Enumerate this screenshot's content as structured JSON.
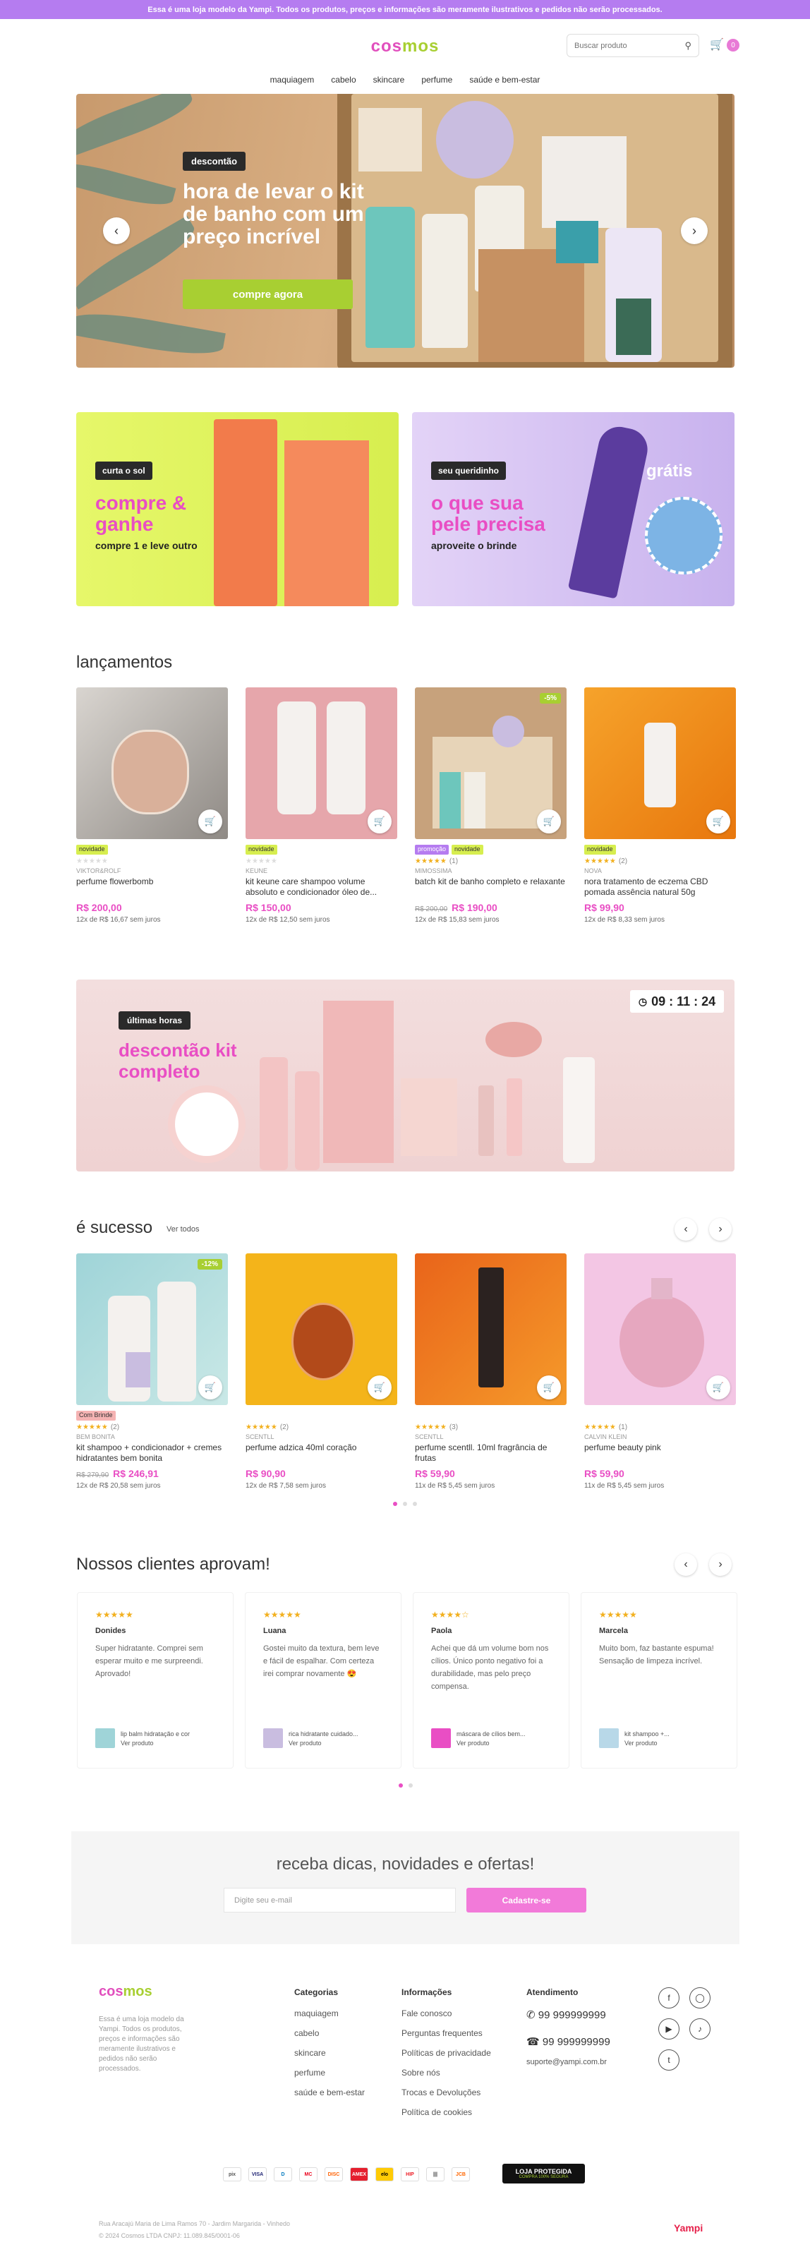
{
  "topbar": "Essa é uma loja modelo da Yampi. Todos os produtos, preços e informações são meramente ilustrativos e pedidos não serão processados.",
  "logo": {
    "part1": "cos",
    "part2": "mos"
  },
  "search": {
    "placeholder": "Buscar produto"
  },
  "cart": {
    "count": "0"
  },
  "nav": [
    "maquiagem",
    "cabelo",
    "skincare",
    "perfume",
    "saúde e bem-estar"
  ],
  "hero": {
    "tag": "descontão",
    "title": "hora de levar o kit de banho com um preço incrível",
    "button": "compre agora"
  },
  "promos": [
    {
      "tag": "curta o sol",
      "title": "compre & ganhe",
      "subtitle": "compre 1 e leve outro"
    },
    {
      "tag": "seu queridinho",
      "title": "o que sua pele precisa",
      "subtitle": "aproveite o brinde",
      "extra": "grátis"
    }
  ],
  "launches": {
    "title": "lançamentos",
    "products": [
      {
        "badges": [
          "novidade"
        ],
        "rating": "",
        "brand": "VIKTOR&ROLF",
        "name": "perfume flowerbomb",
        "old": "",
        "price": "R$ 200,00",
        "inst": "12x de R$ 16,67 sem juros",
        "discount": ""
      },
      {
        "badges": [
          "novidade"
        ],
        "rating": "",
        "brand": "KEUNE",
        "name": "kit keune care shampoo volume absoluto e condicionador óleo de...",
        "old": "",
        "price": "R$ 150,00",
        "inst": "12x de R$ 12,50 sem juros",
        "discount": ""
      },
      {
        "badges": [
          "promoção",
          "novidade"
        ],
        "rating": "(1)",
        "brand": "MIMOSSIMA",
        "name": "batch kit de banho completo e relaxante",
        "old": "R$ 200,00",
        "price": "R$ 190,00",
        "inst": "12x de R$ 15,83 sem juros",
        "discount": "-5%"
      },
      {
        "badges": [
          "novidade"
        ],
        "rating": "(2)",
        "brand": "NOVA",
        "name": "nora tratamento de eczema CBD pomada assência natural 50g",
        "old": "",
        "price": "R$ 99,90",
        "inst": "12x de R$ 8,33 sem juros",
        "discount": ""
      }
    ]
  },
  "banner2": {
    "tag": "últimas horas",
    "title": "descontão kit completo",
    "timer": "09 : 11 : 24"
  },
  "success": {
    "title": "é sucesso",
    "link": "Ver todos",
    "products": [
      {
        "badges": [
          "Com Brinde"
        ],
        "rating": "(2)",
        "brand": "BEM BONITA",
        "name": "kit shampoo + condicionador + cremes hidratantes bem bonita",
        "old": "R$ 279,90",
        "price": "R$ 246,91",
        "inst": "12x de R$ 20,58 sem juros",
        "discount": "-12%"
      },
      {
        "badges": [],
        "rating": "(2)",
        "brand": "SCENTLL",
        "name": "perfume adzica 40ml coração",
        "old": "",
        "price": "R$ 90,90",
        "inst": "12x de R$ 7,58 sem juros",
        "discount": ""
      },
      {
        "badges": [],
        "rating": "(3)",
        "brand": "SCENTLL",
        "name": "perfume scentll. 10ml fragrância de frutas",
        "old": "",
        "price": "R$ 59,90",
        "inst": "11x de R$ 5,45 sem juros",
        "discount": ""
      },
      {
        "badges": [],
        "rating": "(1)",
        "brand": "CALVIN KLEIN",
        "name": "perfume beauty pink",
        "old": "",
        "price": "R$ 59,90",
        "inst": "11x de R$ 5,45 sem juros",
        "discount": ""
      }
    ]
  },
  "reviews": {
    "title": "Nossos clientes aprovam!",
    "items": [
      {
        "name": "Donides",
        "text": "Super hidratante. Comprei sem esperar muito e me surpreendi. Aprovado!",
        "product": "lip balm hidratação e cor",
        "link": "Ver produto",
        "stars": "★★★★★"
      },
      {
        "name": "Luana",
        "text": "Gostei muito da textura, bem leve e fácil de espalhar. Com certeza irei comprar novamente 😍",
        "product": "rica hidratante cuidado...",
        "link": "Ver produto",
        "stars": "★★★★★"
      },
      {
        "name": "Paola",
        "text": "Achei que dá um volume bom nos cílios. Único ponto negativo foi a durabilidade, mas pelo preço compensa.",
        "product": "máscara de cílios bem...",
        "link": "Ver produto",
        "stars": "★★★★☆"
      },
      {
        "name": "Marcela",
        "text": "Muito bom, faz bastante espuma! Sensação de limpeza incrível.",
        "product": "kit shampoo +...",
        "link": "Ver produto",
        "stars": "★★★★★"
      }
    ]
  },
  "newsletter": {
    "title": "receba dicas, novidades e ofertas!",
    "placeholder": "Digite seu e-mail",
    "button": "Cadastre-se"
  },
  "footer": {
    "about": "Essa é uma loja modelo da Yampi. Todos os produtos, preços e informações são meramente ilustrativos e pedidos não serão processados.",
    "categories_title": "Categorias",
    "categories": [
      "maquiagem",
      "cabelo",
      "skincare",
      "perfume",
      "saúde e bem-estar"
    ],
    "info_title": "Informações",
    "info": [
      "Fale conosco",
      "Perguntas frequentes",
      "Políticas de privacidade",
      "Sobre nós",
      "Trocas e Devoluções",
      "Política de cookies"
    ],
    "support_title": "Atendimento",
    "whatsapp": "99 999999999",
    "phone": "99 999999999",
    "email": "suporte@yampi.com.br",
    "secure": "LOJA PROTEGIDA",
    "secure_sub": "COMPRA 100% SEGURA",
    "address": "Rua Aracajú Maria de Lima Ramos 70 - Jardim Margarida - Vinhedo",
    "copyright": "© 2024 Cosmos LTDA CNPJ: 11.089.845/0001-06",
    "powered": "Yampi"
  },
  "colors": {
    "accent": "#e94ec4",
    "green": "#a8cf32",
    "topbar": "#b57cf0"
  }
}
